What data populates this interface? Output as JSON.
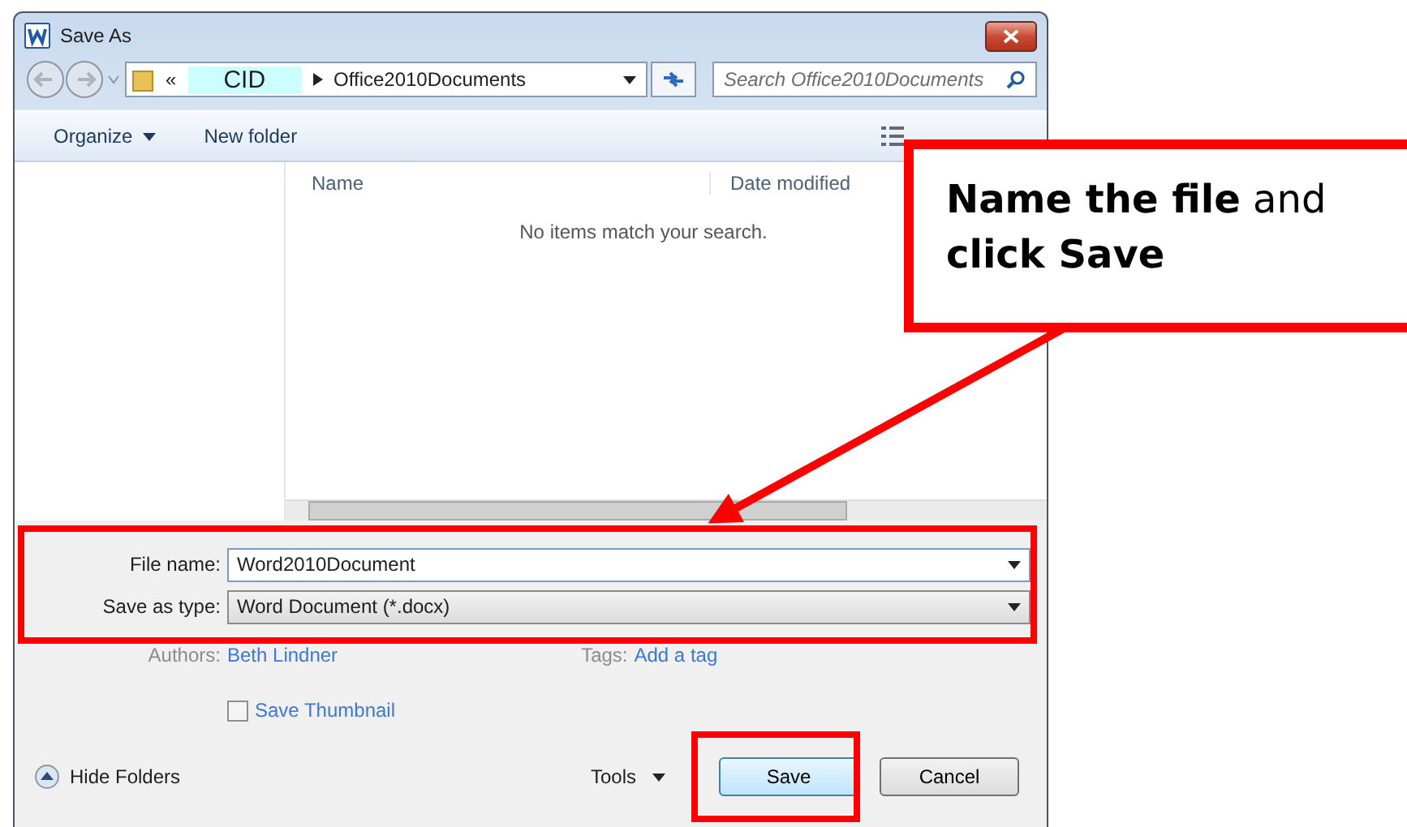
{
  "window": {
    "title": "Save As"
  },
  "address": {
    "parts": [
      "«",
      "CID",
      "Office2010Documents"
    ]
  },
  "search": {
    "placeholder": "Search Office2010Documents"
  },
  "toolbar": {
    "items": [
      "Organize",
      "New folder"
    ]
  },
  "file_list": {
    "columns": [
      "Name",
      "Date modified"
    ],
    "empty_message": "No items match your search."
  },
  "fields": [
    {
      "label": "File name:",
      "value": "Word2010Document",
      "kind": "input"
    },
    {
      "label": "Save as type:",
      "value": "Word Document (*.docx)",
      "kind": "select"
    }
  ],
  "metadata": [
    {
      "label": "Authors:",
      "value": "Beth Lindner"
    },
    {
      "label": "Tags:",
      "value": "Add a tag"
    }
  ],
  "save_thumbnail": {
    "label": "Save Thumbnail",
    "checked": false
  },
  "hide_folders": "Hide Folders",
  "tools": "Tools",
  "buttons": [
    {
      "label": "Save",
      "kind": "primary"
    },
    {
      "label": "Cancel",
      "kind": "normal"
    }
  ],
  "callout": {
    "text": "**Name the file** and **click Save**"
  }
}
